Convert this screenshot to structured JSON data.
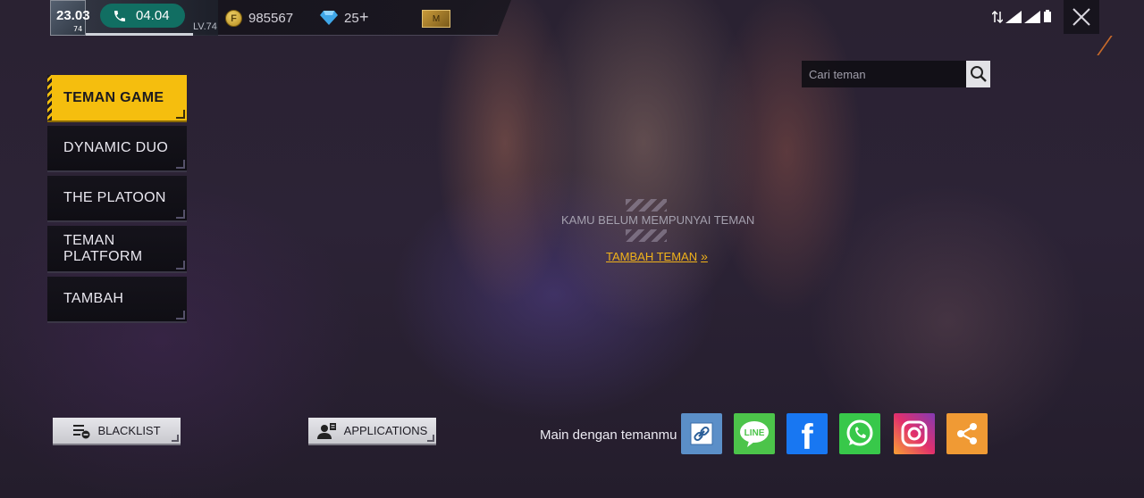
{
  "status_bar": {
    "time": "23.03",
    "call_duration": "04.04",
    "avatar_badge": "74",
    "level": "LV.74"
  },
  "currency": {
    "gold_icon_letter": "F",
    "gold": "985567",
    "diamonds": "25",
    "add_symbol": "+",
    "membership_badge": "M"
  },
  "sidebar": {
    "tabs": [
      {
        "label": "TEMAN GAME",
        "active": true
      },
      {
        "label": "DYNAMIC DUO",
        "active": false
      },
      {
        "label": "THE PLATOON",
        "active": false
      },
      {
        "label": "TEMAN\nPLATFORM",
        "active": false
      },
      {
        "label": "TAMBAH",
        "active": false
      }
    ]
  },
  "search": {
    "placeholder": "Cari teman"
  },
  "empty_state": {
    "message": "KAMU BELUM MEMPUNYAI TEMAN",
    "add_link": "TAMBAH TEMAN",
    "add_link_chevron": "»"
  },
  "bottom": {
    "blacklist_label": "BLACKLIST",
    "applications_label": "APPLICATIONS",
    "play_with_friends": "Main dengan temanmu"
  },
  "social": {
    "line_text": "LINE",
    "facebook_text": "f"
  },
  "colors": {
    "accent_yellow": "#f5be0e",
    "link_orange": "#f0b21a",
    "call_green": "#116e62",
    "line_green": "#4cc44a",
    "facebook_blue": "#1877f2",
    "whatsapp_green": "#38c84a",
    "share_orange": "#f09a34",
    "link_blue": "#5b8fc8"
  }
}
